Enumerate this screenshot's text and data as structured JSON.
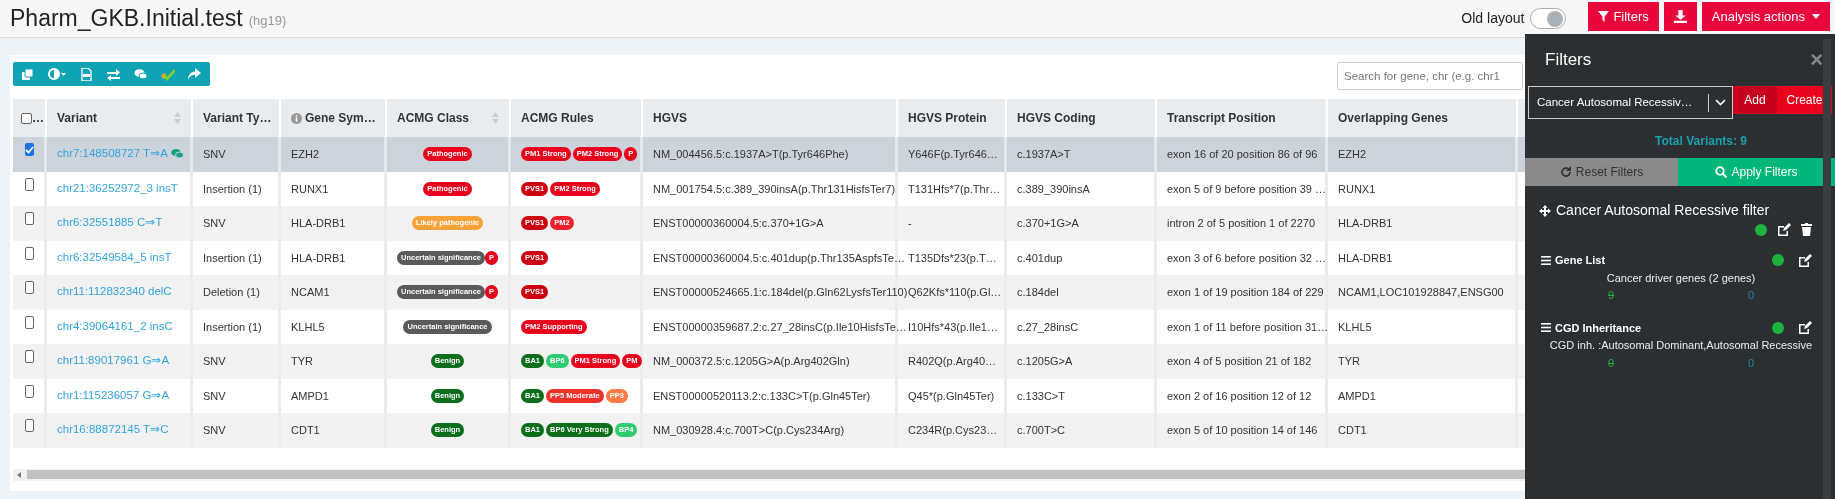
{
  "header": {
    "title": "Pharm_GKB.Initial.test",
    "genome": "(hg19)",
    "old_layout": {
      "label": "Old layout",
      "on": true
    },
    "buttons": [
      {
        "kind": "filter",
        "label": "Filters"
      },
      {
        "kind": "download"
      },
      {
        "kind": "dropdown",
        "label": "Analysis actions"
      }
    ]
  },
  "toolbar": {
    "tools": [
      {
        "kind": "copy"
      },
      {
        "kind": "contrast"
      },
      {
        "kind": "vcf"
      },
      {
        "kind": "swap"
      },
      {
        "kind": "comments"
      },
      {
        "kind": "check"
      },
      {
        "kind": "share"
      }
    ],
    "search": {
      "placeholder": "Search for gene, chr (e.g. chr1"
    }
  },
  "table": {
    "columns": [
      {
        "label": "…",
        "kind": "checkbox",
        "checked": false,
        "sortable": false,
        "info": false
      },
      {
        "label": "Variant",
        "kind": "variant",
        "sortable": true,
        "info": false
      },
      {
        "label": "Variant Ty…",
        "kind": "text",
        "sortable": false,
        "info": false
      },
      {
        "label": "Gene Sym…",
        "kind": "text",
        "sortable": false,
        "info": true
      },
      {
        "label": "ACMG Class",
        "kind": "class",
        "sortable": true,
        "info": false
      },
      {
        "label": "ACMG Rules",
        "kind": "rules",
        "sortable": false,
        "info": false
      },
      {
        "label": "HGVS",
        "kind": "text",
        "sortable": false,
        "info": false
      },
      {
        "label": "HGVS Protein",
        "kind": "text",
        "sortable": false,
        "info": false
      },
      {
        "label": "HGVS Coding",
        "kind": "text",
        "sortable": false,
        "info": false
      },
      {
        "label": "Transcript Position",
        "kind": "text",
        "sortable": false,
        "info": false
      },
      {
        "label": "Overlapping Genes",
        "kind": "text",
        "sortable": false,
        "info": false
      }
    ],
    "rows": [
      {
        "selected": true,
        "variant": "chr7:148508727 T⇒A",
        "comment": true,
        "type": "SNV",
        "gene": "EZH2",
        "acmg_class": [
          {
            "label": "Pathogenic",
            "color": "#e8001c"
          }
        ],
        "acmg_rules": [
          {
            "label": "PM1 Strong",
            "color": "#e8001c"
          },
          {
            "label": "PM2 Strong",
            "color": "#e8001c"
          },
          {
            "label": "P",
            "color": "#e8001c"
          }
        ],
        "hgvs": "NM_004456.5:c.1937A>T(p.Tyr646Phe)",
        "hgvs_protein": "Y646F(p.Tyr646…",
        "hgvs_coding": "c.1937A>T",
        "transcript_position": "exon 16 of 20 position 86 of 96",
        "overlapping_genes": "EZH2"
      },
      {
        "selected": false,
        "variant": "chr21:36252972_3 insT",
        "comment": false,
        "type": "Insertion (1)",
        "gene": "RUNX1",
        "acmg_class": [
          {
            "label": "Pathogenic",
            "color": "#e8001c"
          }
        ],
        "acmg_rules": [
          {
            "label": "PVS1",
            "color": "#cc0010"
          },
          {
            "label": "PM2 Strong",
            "color": "#e8001c"
          }
        ],
        "hgvs": "NM_001754.5:c.389_390insA(p.Thr131HisfsTer7)",
        "hgvs_protein": "T131Hfs*7(p.Thr…",
        "hgvs_coding": "c.389_390insA",
        "transcript_position": "exon 5 of 9 before position 39 …",
        "overlapping_genes": "RUNX1"
      },
      {
        "selected": false,
        "variant": "chr6:32551885 C⇒T",
        "comment": false,
        "type": "SNV",
        "gene": "HLA-DRB1",
        "acmg_class": [
          {
            "label": "Likely pathogenic",
            "color": "#f9a23a"
          }
        ],
        "acmg_rules": [
          {
            "label": "PVS1",
            "color": "#cc0010"
          },
          {
            "label": "PM2",
            "color": "#f0202a"
          }
        ],
        "hgvs": "ENST00000360004.5:c.370+1G>A",
        "hgvs_protein": "-",
        "hgvs_coding": "c.370+1G>A",
        "transcript_position": "intron 2 of 5 position 1 of 2270",
        "overlapping_genes": "HLA-DRB1"
      },
      {
        "selected": false,
        "variant": "chr6:32549584_5 insT",
        "comment": false,
        "type": "Insertion (1)",
        "gene": "HLA-DRB1",
        "acmg_class": [
          {
            "label": "Uncertain significance",
            "color": "#5a5a5a"
          },
          {
            "label": "P",
            "color": "#e8001c"
          }
        ],
        "acmg_rules": [
          {
            "label": "PVS1",
            "color": "#cc0010"
          }
        ],
        "hgvs": "ENST00000360004.5:c.401dup(p.Thr135AspfsTe…",
        "hgvs_protein": "T135Dfs*23(p.T…",
        "hgvs_coding": "c.401dup",
        "transcript_position": "exon 3 of 6 before position 32 …",
        "overlapping_genes": "HLA-DRB1"
      },
      {
        "selected": false,
        "variant": "chr11:112832340 delC",
        "comment": false,
        "type": "Deletion (1)",
        "gene": "NCAM1",
        "acmg_class": [
          {
            "label": "Uncertain significance",
            "color": "#5a5a5a"
          },
          {
            "label": "P",
            "color": "#e8001c"
          }
        ],
        "acmg_rules": [
          {
            "label": "PVS1",
            "color": "#cc0010"
          }
        ],
        "hgvs": "ENST00000524665.1:c.184del(p.Gln62LysfsTer110)",
        "hgvs_protein": "Q62Kfs*110(p.Gl…",
        "hgvs_coding": "c.184del",
        "transcript_position": "exon 1 of 19 position 184 of 229",
        "overlapping_genes": "NCAM1,LOC101928847,ENSG00"
      },
      {
        "selected": false,
        "variant": "chr4:39064161_2 insC",
        "comment": false,
        "type": "Insertion (1)",
        "gene": "KLHL5",
        "acmg_class": [
          {
            "label": "Uncertain significance",
            "color": "#5a5a5a"
          }
        ],
        "acmg_rules": [
          {
            "label": "PM2 Supporting",
            "color": "#e8001c"
          }
        ],
        "hgvs": "ENST00000359687.2:c.27_28insC(p.Ile10HisfsTe…",
        "hgvs_protein": "I10Hfs*43(p.Ile1…",
        "hgvs_coding": "c.27_28insC",
        "transcript_position": "exon 1 of 11 before position 31…",
        "overlapping_genes": "KLHL5"
      },
      {
        "selected": false,
        "variant": "chr11:89017961 G⇒A",
        "comment": false,
        "type": "SNV",
        "gene": "TYR",
        "acmg_class": [
          {
            "label": "Benign",
            "color": "#0b6e1a"
          }
        ],
        "acmg_rules": [
          {
            "label": "BA1",
            "color": "#0b6e1a"
          },
          {
            "label": "BP6",
            "color": "#2ecc71"
          },
          {
            "label": "PM1 Strong",
            "color": "#e8001c"
          },
          {
            "label": "PM",
            "color": "#e8001c"
          }
        ],
        "hgvs": "NM_000372.5:c.1205G>A(p.Arg402Gln)",
        "hgvs_protein": "R402Q(p.Arg40…",
        "hgvs_coding": "c.1205G>A",
        "transcript_position": "exon 4 of 5 position 21 of 182",
        "overlapping_genes": "TYR"
      },
      {
        "selected": false,
        "variant": "chr1:115236057 G⇒A",
        "comment": false,
        "type": "SNV",
        "gene": "AMPD1",
        "acmg_class": [
          {
            "label": "Benign",
            "color": "#0b6e1a"
          }
        ],
        "acmg_rules": [
          {
            "label": "BA1",
            "color": "#0b6e1a"
          },
          {
            "label": "PP5 Moderate",
            "color": "#f0302a"
          },
          {
            "label": "PP3",
            "color": "#ff7a45"
          }
        ],
        "hgvs": "ENST00000520113.2:c.133C>T(p.Gln45Ter)",
        "hgvs_protein": "Q45*(p.Gln45Ter)",
        "hgvs_coding": "c.133C>T",
        "transcript_position": "exon 2 of 16 position 12 of 12",
        "overlapping_genes": "AMPD1"
      },
      {
        "selected": false,
        "variant": "chr16:88872145 T⇒C",
        "comment": false,
        "type": "SNV",
        "gene": "CDT1",
        "acmg_class": [
          {
            "label": "Benign",
            "color": "#0b6e1a"
          }
        ],
        "acmg_rules": [
          {
            "label": "BA1",
            "color": "#0b6e1a"
          },
          {
            "label": "BP6 Very Strong",
            "color": "#0b6e1a"
          },
          {
            "label": "BP4",
            "color": "#2ecc71"
          }
        ],
        "hgvs": "NM_030928.4:c.700T>C(p.Cys234Arg)",
        "hgvs_protein": "C234R(p.Cys23…",
        "hgvs_coding": "c.700T>C",
        "transcript_position": "exon 5 of 10 position 14 of 146",
        "overlapping_genes": "CDT1"
      }
    ]
  },
  "filters_panel": {
    "title": "Filters",
    "close": "×",
    "select": {
      "value": "Cancer Autosomal Recessiv…"
    },
    "buttons": [
      {
        "label": "Add",
        "kind": "add"
      },
      {
        "label": "Create",
        "kind": "create"
      }
    ],
    "total": "Total Variants: 9",
    "actions": [
      {
        "label": "Reset Filters",
        "kind": "reset"
      },
      {
        "label": "Apply Filters",
        "kind": "apply"
      }
    ],
    "filter": {
      "title": "Cancer Autosomal Recessive filter",
      "active": true,
      "rules": [
        {
          "title": "Gene List",
          "active": true,
          "description": "Cancer driver genes (2 genes)",
          "count_before": "9",
          "count_after": "0"
        },
        {
          "title": "CGD Inheritance",
          "active": true,
          "description": "CGD inh. :Autosomal Dominant,Autosomal Recessive",
          "count_before": "0",
          "count_after": "0"
        }
      ]
    }
  }
}
